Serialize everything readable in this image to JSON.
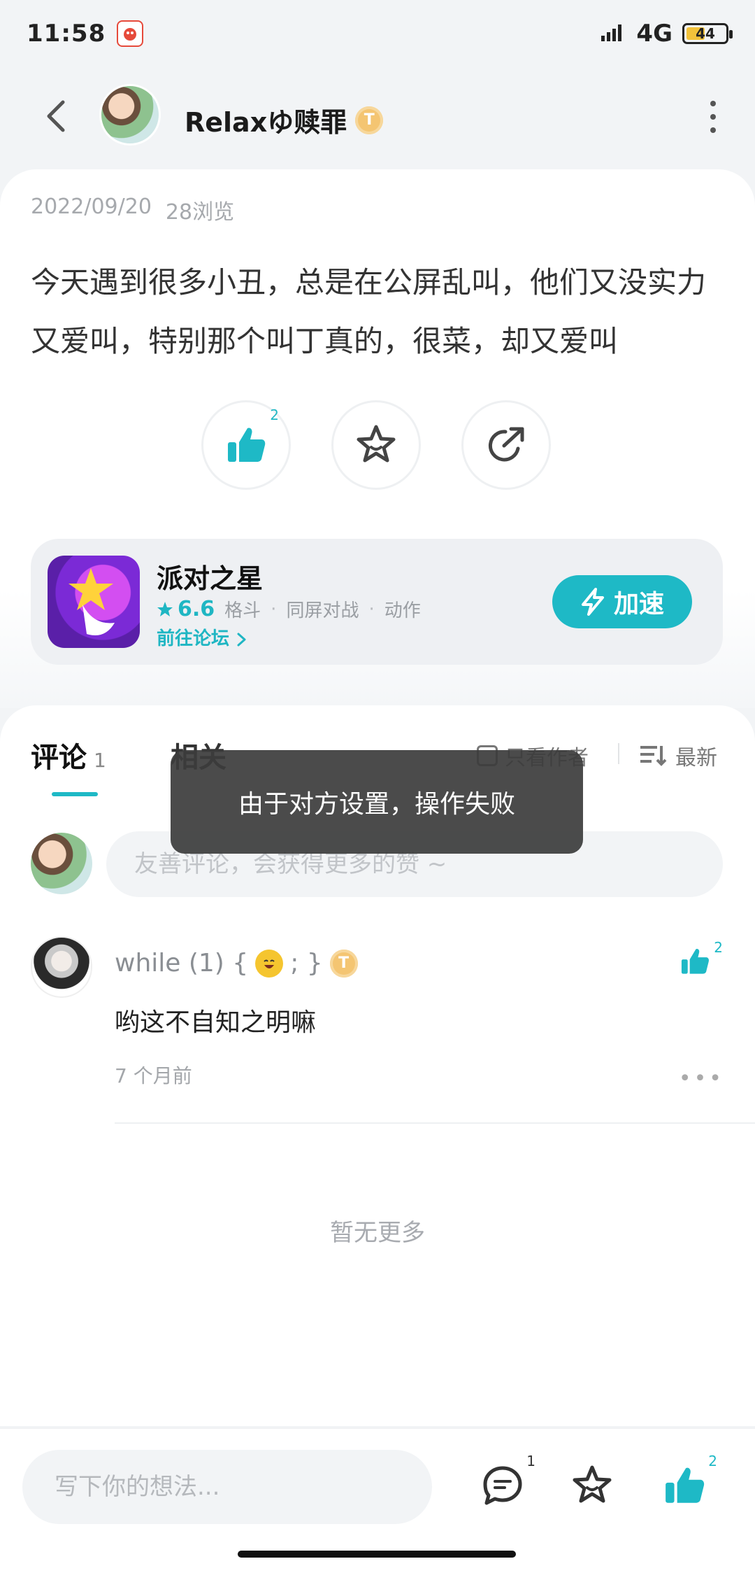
{
  "status_bar": {
    "time": "11:58",
    "network": "4G",
    "battery": "44"
  },
  "header": {
    "username": "Relaxゆ赎罪",
    "badge": "T"
  },
  "post": {
    "date": "2022/09/20",
    "views": "28浏览",
    "text": "今天遇到很多小丑，总是在公屏乱叫，他们又没实力又爱叫，特别那个叫丁真的，很菜，却又爱叫",
    "like_count": "2"
  },
  "game": {
    "name": "派对之星",
    "score": "6.6",
    "tags": [
      "格斗",
      "同屏对战",
      "动作"
    ],
    "forum_link": "前往论坛",
    "accelerate_label": "加速"
  },
  "comments_section": {
    "tab_comments": "评论",
    "tab_comments_count": "1",
    "tab_related": "相关",
    "filter_author": "只看作者",
    "sort_latest": "最新",
    "input_placeholder": "友善评论，会获得更多的赞 ~",
    "comments": [
      {
        "author_prefix": "while (1) {",
        "author_suffix": "; }",
        "badge": "T",
        "text": "哟这不自知之明嘛",
        "time": "7 个月前",
        "like_count": "2"
      }
    ],
    "no_more": "暂无更多"
  },
  "toast": {
    "message": "由于对方设置，操作失败"
  },
  "bottom_bar": {
    "input_placeholder": "写下你的想法...",
    "comment_count": "1",
    "like_count": "2"
  },
  "colors": {
    "accent": "#1eb9c6",
    "toast_bg": "#3c3c3c",
    "badge_gold": "#f4c572"
  }
}
